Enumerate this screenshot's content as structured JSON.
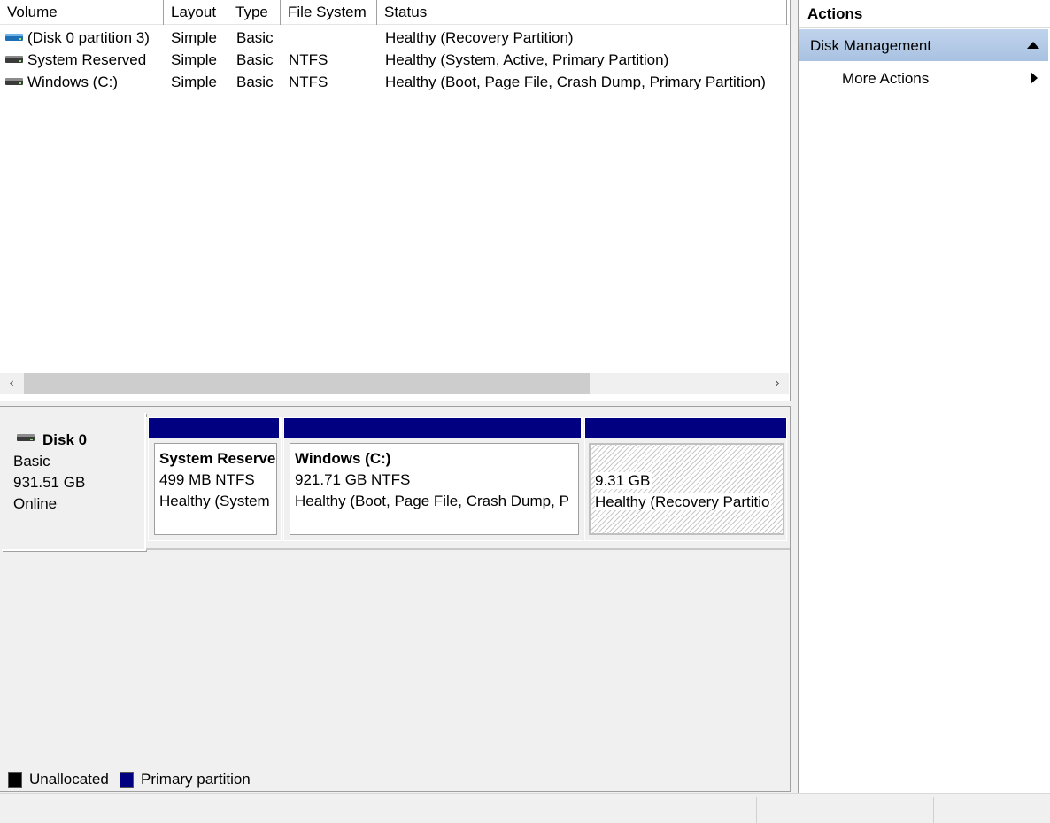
{
  "volume_list": {
    "columns": [
      "Volume",
      "Layout",
      "Type",
      "File System",
      "Status"
    ],
    "rows": [
      {
        "icon": "blue-drive-icon",
        "volume": "(Disk 0 partition 3)",
        "layout": "Simple",
        "type": "Basic",
        "file_system": "",
        "status": "Healthy (Recovery Partition)"
      },
      {
        "icon": "drive-icon",
        "volume": "System Reserved",
        "layout": "Simple",
        "type": "Basic",
        "file_system": "NTFS",
        "status": "Healthy (System, Active, Primary Partition)"
      },
      {
        "icon": "drive-icon",
        "volume": "Windows (C:)",
        "layout": "Simple",
        "type": "Basic",
        "file_system": "NTFS",
        "status": "Healthy (Boot, Page File, Crash Dump, Primary Partition)"
      }
    ],
    "scroll_left": "‹",
    "scroll_right": "›"
  },
  "disk": {
    "name": "Disk 0",
    "type": "Basic",
    "size": "931.51 GB",
    "state": "Online",
    "partitions": [
      {
        "name": "System Reserve",
        "size_fs": "499 MB NTFS",
        "status": "Healthy (System"
      },
      {
        "name": "Windows  (C:)",
        "size_fs": "921.71 GB NTFS",
        "status": "Healthy (Boot, Page File, Crash Dump, P"
      },
      {
        "name": "",
        "size_fs": "9.31 GB",
        "status": "Healthy (Recovery Partitio"
      }
    ]
  },
  "legend": [
    {
      "label": "Unallocated",
      "color": "#000000"
    },
    {
      "label": "Primary partition",
      "color": "#000080"
    }
  ],
  "actions": {
    "title": "Actions",
    "group": "Disk Management",
    "items": [
      "More Actions"
    ]
  },
  "colors": {
    "primary_partition_bar": "#000080",
    "actions_group_bg": "#b6cbe8"
  }
}
